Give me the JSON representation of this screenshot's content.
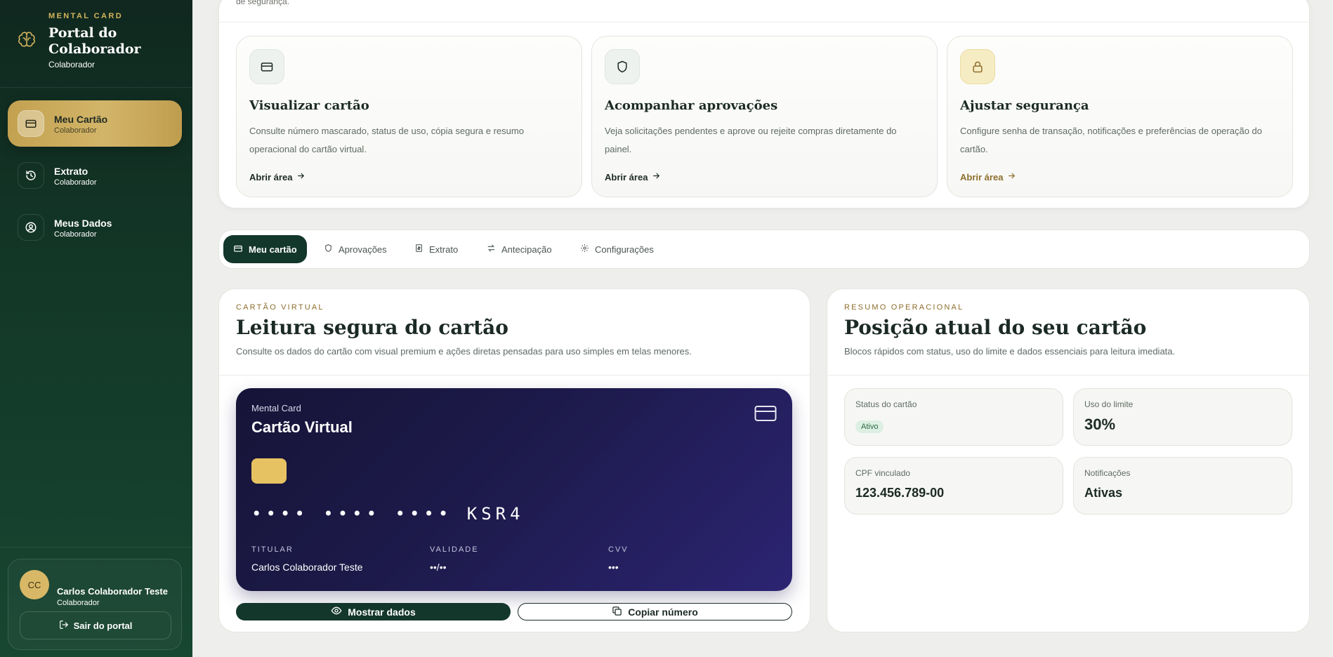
{
  "brand": {
    "eyebrow": "MENTAL CARD",
    "title": "Portal do Colaborador",
    "subtitle": "Colaborador",
    "icon": "brain-icon"
  },
  "sidebar": {
    "items": [
      {
        "label": "Meu Cartão",
        "sub": "Colaborador",
        "icon": "card-icon",
        "active": true
      },
      {
        "label": "Extrato",
        "sub": "Colaborador",
        "icon": "history-icon",
        "active": false
      },
      {
        "label": "Meus Dados",
        "sub": "Colaborador",
        "icon": "user-circle-icon",
        "active": false
      }
    ],
    "user": {
      "initials": "CC",
      "name": "Carlos Colaborador Teste",
      "role": "Colaborador"
    },
    "logout_label": "Sair do portal"
  },
  "top": {
    "partial_text": "de segurança.",
    "cards": [
      {
        "title": "Visualizar cartão",
        "desc": "Consulte número mascarado, status de uso, cópia segura e resumo operacional do cartão virtual.",
        "link": "Abrir área",
        "icon": "card-icon"
      },
      {
        "title": "Acompanhar aprovações",
        "desc": "Veja solicitações pendentes e aprove ou rejeite compras diretamente do painel.",
        "link": "Abrir área",
        "icon": "shield-icon"
      },
      {
        "title": "Ajustar segurança",
        "desc": "Configure senha de transação, notificações e preferências de operação do cartão.",
        "link": "Abrir área",
        "icon": "lock-icon"
      }
    ]
  },
  "tabs": [
    {
      "label": "Meu cartão",
      "icon": "card-icon",
      "active": true
    },
    {
      "label": "Aprovações",
      "icon": "shield-icon",
      "active": false
    },
    {
      "label": "Extrato",
      "icon": "receipt-icon",
      "active": false
    },
    {
      "label": "Antecipação",
      "icon": "swap-icon",
      "active": false
    },
    {
      "label": "Configurações",
      "icon": "gear-icon",
      "active": false
    }
  ],
  "card_panel": {
    "eyebrow": "CARTÃO VIRTUAL",
    "title": "Leitura segura do cartão",
    "subtitle": "Consulte os dados do cartão com visual premium e ações diretas pensadas para uso simples em telas menores.",
    "card": {
      "brand": "Mental Card",
      "name": "Cartão Virtual",
      "number": "•••• •••• •••• KSR4",
      "holder_label": "TITULAR",
      "holder": "Carlos Colaborador Teste",
      "expiry_label": "VALIDADE",
      "expiry": "••/••",
      "cvv_label": "CVV",
      "cvv": "•••"
    },
    "show_button": "Mostrar dados",
    "copy_button": "Copiar número"
  },
  "summary_panel": {
    "eyebrow": "RESUMO OPERACIONAL",
    "title": "Posição atual do seu cartão",
    "subtitle": "Blocos rápidos com status, uso do limite e dados essenciais para leitura imediata.",
    "stats": [
      {
        "label": "Status do cartão",
        "badge": "Ativo"
      },
      {
        "label": "Uso do limite",
        "value": "30%"
      },
      {
        "label": "CPF vinculado",
        "value": "123.456.789-00"
      },
      {
        "label": "Notificações",
        "value": "Ativas"
      }
    ]
  },
  "colors": {
    "sidebar": "#133828",
    "gold": "#d3b569",
    "primary": "#13372a",
    "card": "#1d1a4b"
  }
}
